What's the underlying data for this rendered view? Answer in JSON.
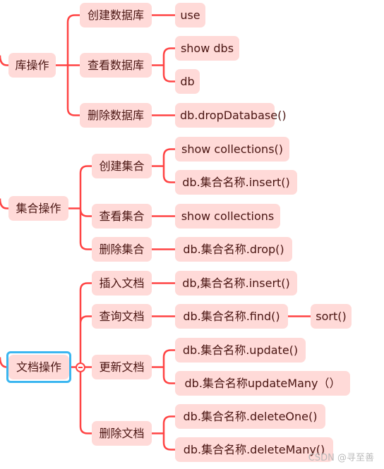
{
  "accent_color": "#ff4444",
  "node_color": "#ffdad8",
  "selection_color": "#3bb6f0",
  "groups": [
    {
      "label": "库操作",
      "children": [
        {
          "label": "创建数据库",
          "children": [
            "use"
          ]
        },
        {
          "label": "查看数据库",
          "children": [
            "show dbs",
            "db"
          ]
        },
        {
          "label": "删除数据库",
          "children": [
            "db.dropDatabase()"
          ]
        }
      ]
    },
    {
      "label": "集合操作",
      "children": [
        {
          "label": "创建集合",
          "children": [
            "show collections()",
            "db.集合名称.insert()"
          ]
        },
        {
          "label": "查看集合",
          "children": [
            "show collections"
          ]
        },
        {
          "label": "删除集合",
          "children": [
            "db.集合名称.drop()"
          ]
        }
      ]
    },
    {
      "label": "文档操作",
      "selected": true,
      "children": [
        {
          "label": "插入文档",
          "children": [
            "db,集合名称.insert()"
          ]
        },
        {
          "label": "查询文档",
          "children": [
            "db.集合名称.find()"
          ],
          "grandchild": "sort()"
        },
        {
          "label": "更新文档",
          "children": [
            "db.集合名称.update()",
            "db.集合名称updateMany（）"
          ]
        },
        {
          "label": "删除文档",
          "children": [
            "db.集合名称.deleteOne()",
            "db.集合名称.deleteMany()"
          ]
        }
      ]
    }
  ],
  "watermark": "CSDN @寻至善"
}
